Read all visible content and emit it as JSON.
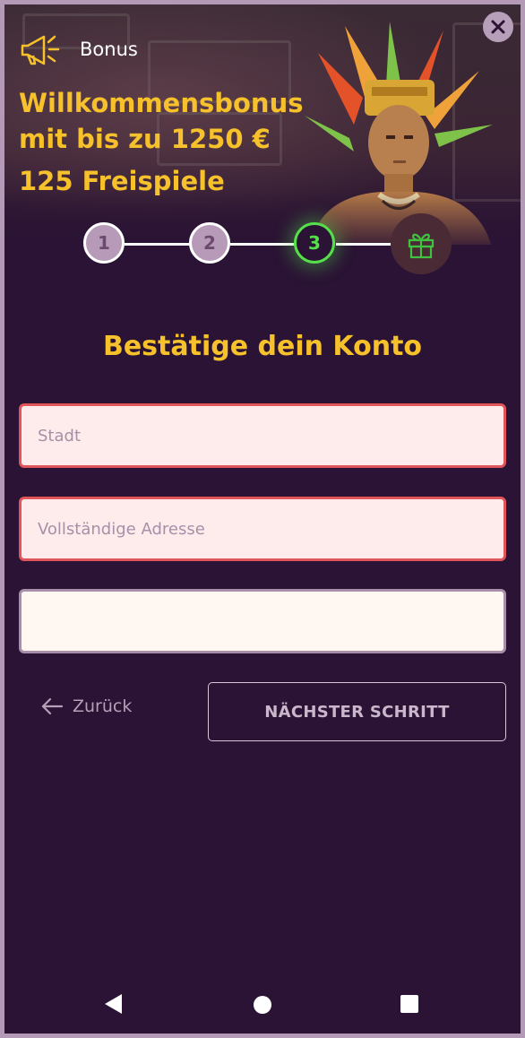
{
  "header": {
    "bonus_label": "Bonus",
    "headline": "Willkommensbonus mit bis zu 1250 €",
    "freespins": "125 Freispiele"
  },
  "stepper": {
    "steps": [
      {
        "label": "1",
        "state": "done"
      },
      {
        "label": "2",
        "state": "done"
      },
      {
        "label": "3",
        "state": "active"
      }
    ],
    "final_icon": "gift-icon"
  },
  "form": {
    "title": "Bestätige dein Konto",
    "city_placeholder": "Stadt",
    "address_placeholder": "Vollständige Adresse",
    "third_value": ""
  },
  "actions": {
    "back_label": "Zurück",
    "next_label": "NÄCHSTER SCHRITT"
  },
  "colors": {
    "background": "#2a1334",
    "accent_yellow": "#f6c12a",
    "active_green": "#55e04a",
    "error_red": "#e0555a"
  }
}
